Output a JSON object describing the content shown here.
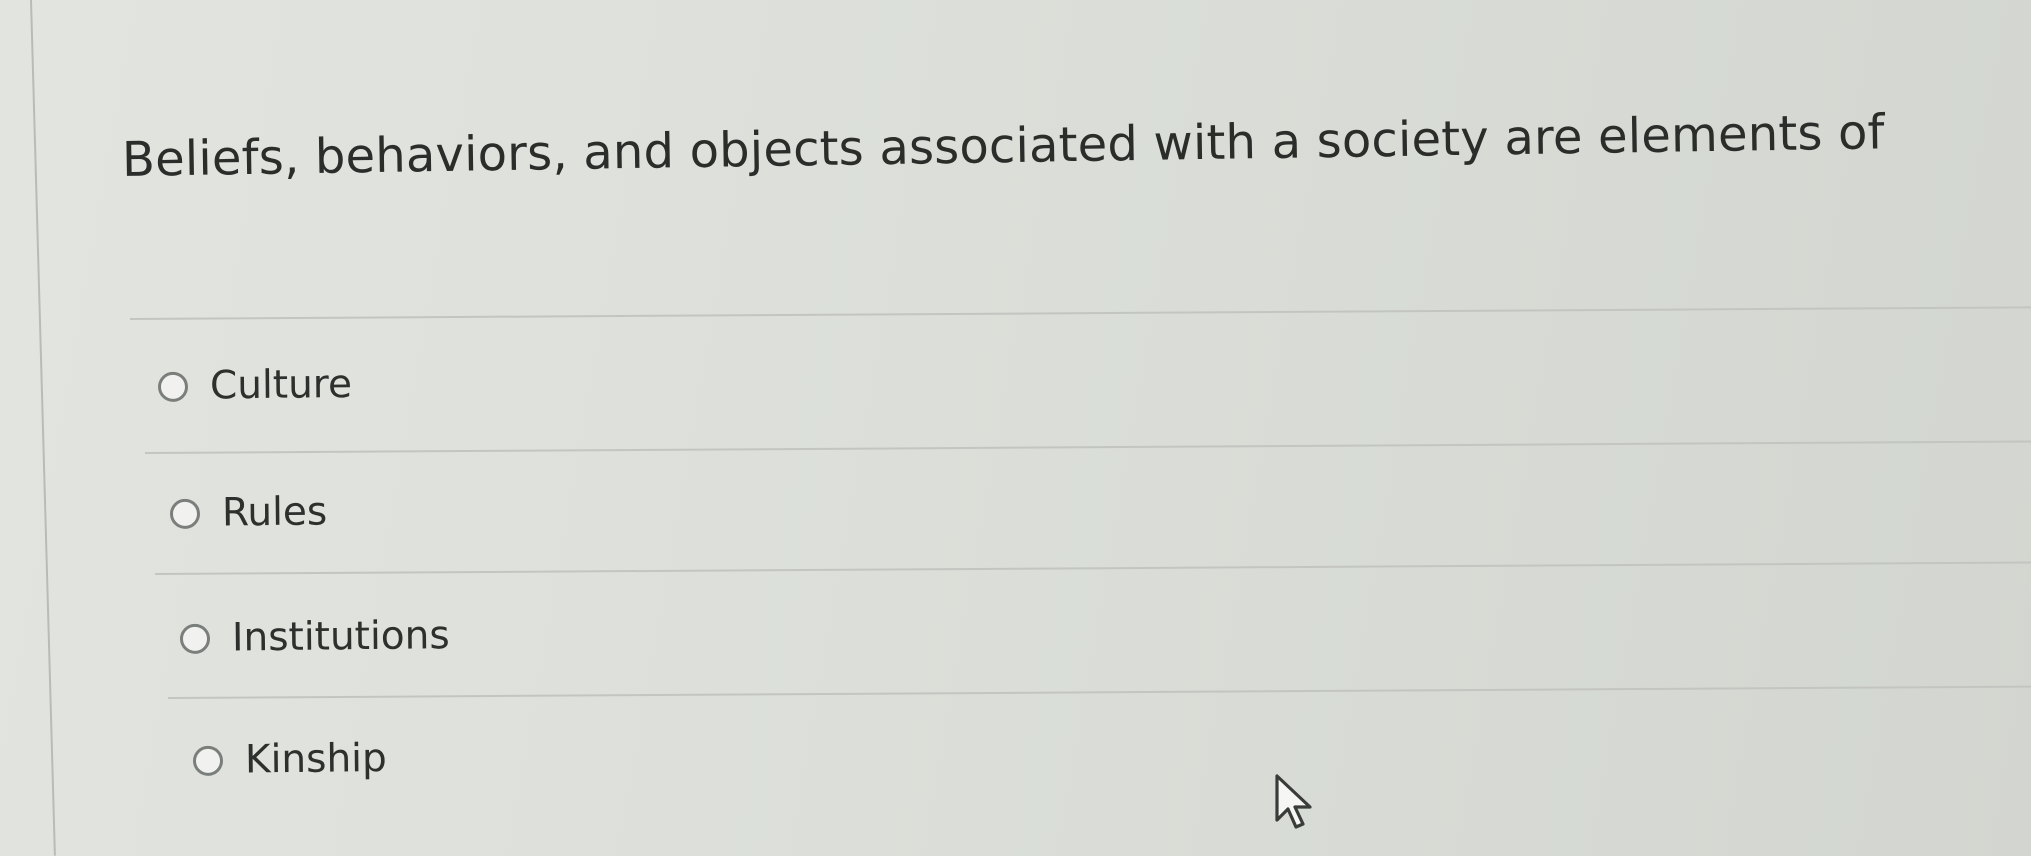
{
  "question": {
    "text": "Beliefs, behaviors, and objects associated with a society are elements of"
  },
  "answers": [
    {
      "label": "Culture",
      "selected": false
    },
    {
      "label": "Rules",
      "selected": false
    },
    {
      "label": "Institutions",
      "selected": false
    },
    {
      "label": "Kinship",
      "selected": false
    }
  ],
  "icons": {
    "radio": "radio-button-icon",
    "cursor": "mouse-pointer-icon"
  },
  "colors": {
    "background": "#dcdfd9",
    "text": "#2b2d2b",
    "divider": "#c3c6c0",
    "radio_border": "#7b7f7b"
  }
}
